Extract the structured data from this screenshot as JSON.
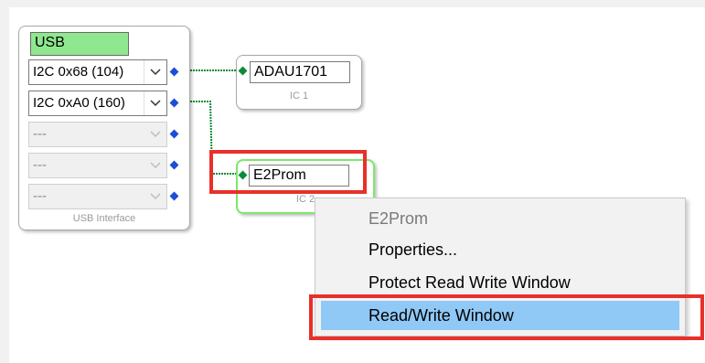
{
  "usb_interface": {
    "title": "USB",
    "ports": [
      {
        "label": "I2C 0x68 (104)",
        "enabled": true
      },
      {
        "label": "I2C 0xA0 (160)",
        "enabled": true
      },
      {
        "label": "---",
        "enabled": false
      },
      {
        "label": "---",
        "enabled": false
      },
      {
        "label": "---",
        "enabled": false
      }
    ],
    "caption": "USB Interface"
  },
  "ic1": {
    "name": "ADAU1701",
    "caption": "IC 1"
  },
  "ic2": {
    "name": "E2Prom",
    "caption": "IC 2"
  },
  "context_menu": {
    "items": [
      {
        "label": "E2Prom",
        "type": "header"
      },
      {
        "label": "Properties...",
        "type": "item"
      },
      {
        "label": "Protect Read Write Window",
        "type": "item"
      },
      {
        "label": "Read/Write Window",
        "type": "item",
        "highlighted": true
      }
    ]
  },
  "colors": {
    "usb_title_bg": "#8fe88f",
    "connector": "#0b8a3b",
    "port": "#1a4fd6",
    "highlight_box": "#e8302a",
    "menu_hover": "#90c8f6",
    "ic2_border": "#7de86a"
  }
}
